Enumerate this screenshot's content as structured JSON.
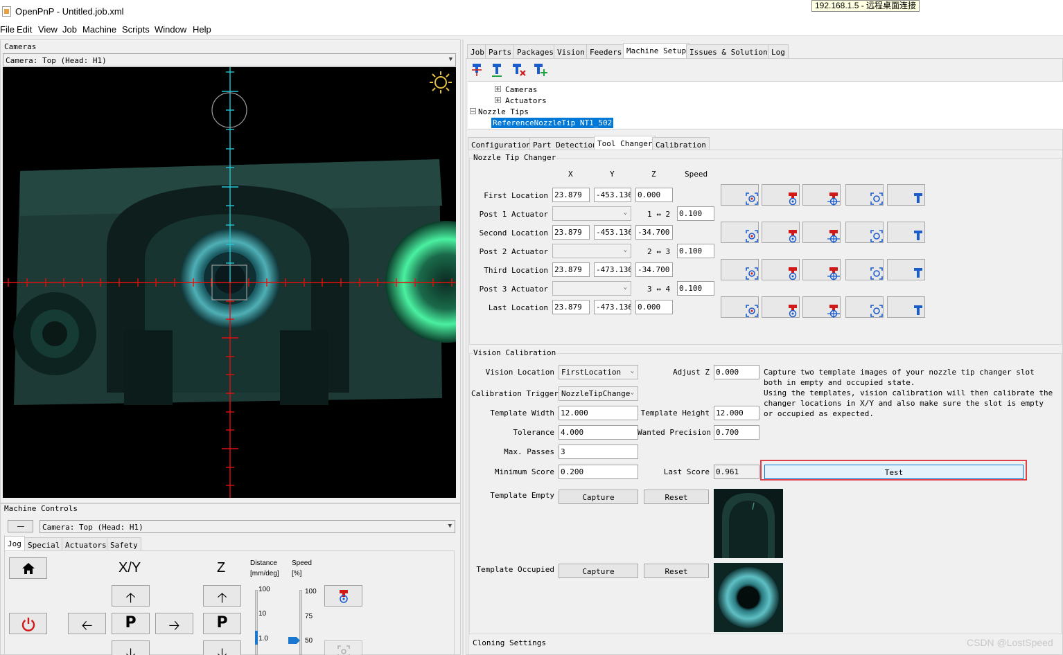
{
  "window": {
    "title": "OpenPnP - Untitled.job.xml",
    "remote_tooltip": "192.168.1.5 - 远程桌面连接"
  },
  "menu": [
    "File",
    "Edit",
    "View",
    "Job",
    "Machine",
    "Scripts",
    "Window",
    "Help"
  ],
  "cameras_panel": {
    "title": "Cameras",
    "camera_select": "Camera: Top (Head: H1)"
  },
  "machine_controls": {
    "title": "Machine Controls",
    "camera_select": "Camera: Top (Head: H1)",
    "tabs": [
      "Jog",
      "Special",
      "Actuators",
      "Safety"
    ],
    "selected_tab": "Jog",
    "xy_label": "X/Y",
    "z_label": "Z",
    "distance_label": "Distance",
    "distance_unit": "[mm/deg]",
    "speed_label": "Speed",
    "speed_unit": "[%]",
    "distance_ticks": [
      "100",
      "10",
      "1.0"
    ],
    "speed_ticks": [
      "100",
      "75",
      "50"
    ],
    "speed_value_percent": 50,
    "distance_value": 1.0,
    "park_label": "P"
  },
  "right_tabs": [
    "Job",
    "Parts",
    "Packages",
    "Vision",
    "Feeders",
    "Machine Setup",
    "Issues & Solutions",
    "Log"
  ],
  "right_selected_tab": "Machine Setup",
  "tree": {
    "items": [
      "Cameras",
      "Actuators",
      "Nozzle Tips",
      "ReferenceNozzleTip NT1_502"
    ],
    "selected": "ReferenceNozzleTip NT1_502"
  },
  "sub_tabs": [
    "Configuration",
    "Part Detection",
    "Tool Changer",
    "Calibration"
  ],
  "sub_selected": "Tool Changer",
  "tool_changer": {
    "section_title": "Nozzle Tip Changer",
    "headers": {
      "x": "X",
      "y": "Y",
      "z": "Z",
      "speed": "Speed"
    },
    "first": {
      "label": "First Location",
      "x": "23.879",
      "y": "-453.136",
      "z": "0.000"
    },
    "post1": {
      "label": "Post 1 Actuator",
      "range": "1 ↔ 2",
      "speed": "0.100"
    },
    "second": {
      "label": "Second Location",
      "x": "23.879",
      "y": "-453.136",
      "z": "-34.700"
    },
    "post2": {
      "label": "Post 2 Actuator",
      "range": "2 ↔ 3",
      "speed": "0.100"
    },
    "third": {
      "label": "Third Location",
      "x": "23.879",
      "y": "-473.136",
      "z": "-34.700"
    },
    "post3": {
      "label": "Post 3 Actuator",
      "range": "3 ↔ 4",
      "speed": "0.100"
    },
    "last": {
      "label": "Last Location",
      "x": "23.879",
      "y": "-473.136",
      "z": "0.000"
    }
  },
  "vision": {
    "section_title": "Vision Calibration",
    "vision_location_label": "Vision Location",
    "vision_location": "FirstLocation",
    "trigger_label": "Calibration Trigger",
    "trigger": "NozzleTipChange",
    "adjust_z_label": "Adjust Z",
    "adjust_z": "0.000",
    "template_width_label": "Template Width",
    "template_width": "12.000",
    "template_height_label": "Template Height",
    "template_height": "12.000",
    "tolerance_label": "Tolerance",
    "tolerance": "4.000",
    "wanted_precision_label": "Wanted Precision",
    "wanted_precision": "0.700",
    "max_passes_label": "Max. Passes",
    "max_passes": "3",
    "min_score_label": "Minimum Score",
    "min_score": "0.200",
    "last_score_label": "Last Score",
    "last_score": "0.961",
    "test_button": "Test",
    "help_lines": [
      "Capture two template images of your nozzle tip changer slot",
      "both in empty and occupied state.",
      "Using the templates, vision calibration will then calibrate the",
      "changer locations in X/Y and also make sure the slot is empty",
      "or occupied as expected."
    ],
    "template_empty_label": "Template Empty",
    "template_occupied_label": "Template Occupied",
    "capture_label": "Capture",
    "reset_label": "Reset"
  },
  "cloning_title": "Cloning Settings",
  "watermark": "CSDN @LostSpeed",
  "colors": {
    "selection": "#0078d7",
    "crosshair_red": "#e01010",
    "crosshair_cyan": "#20c8d8",
    "test_highlight": "#e0404a",
    "icon_blue": "#1a5ccc",
    "icon_red": "#d01818"
  }
}
